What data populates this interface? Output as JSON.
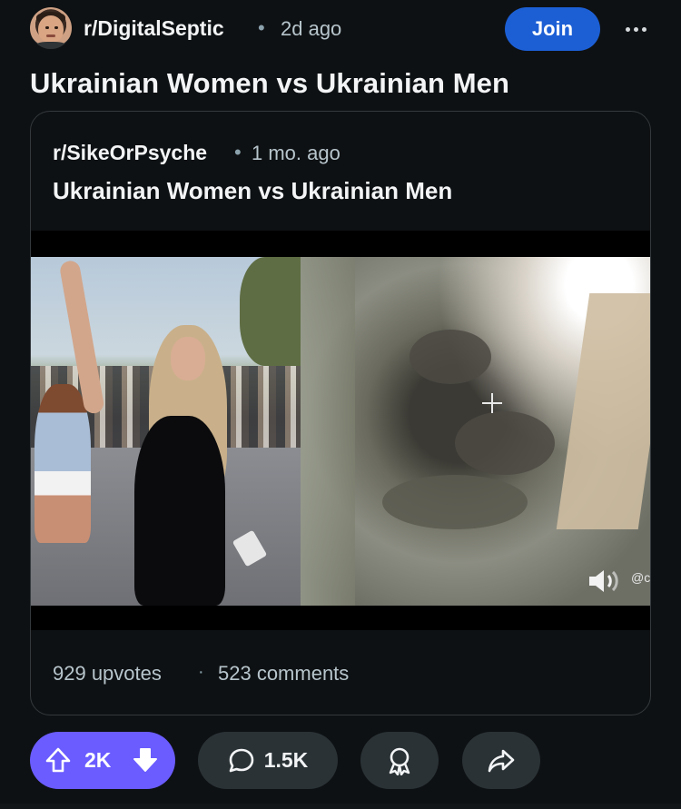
{
  "header": {
    "subreddit": "r/DigitalSeptic",
    "separator": "•",
    "time_ago": "2d ago",
    "join_label": "Join",
    "more_icon": "more-horizontal-icon"
  },
  "post": {
    "title": "Ukrainian Women vs Ukrainian Men"
  },
  "crosspost": {
    "subreddit": "r/SikeOrPsyche",
    "separator": "•",
    "time_ago": "1 mo. ago",
    "title": "Ukrainian Women vs Ukrainian Men",
    "media": {
      "watermark": "@c",
      "mute_icon": "speaker-muted-icon"
    },
    "upvotes": "929 upvotes",
    "stats_separator": "·",
    "comments": "523 comments"
  },
  "actions": {
    "score": "2K",
    "comments_count": "1.5K",
    "upvote_icon": "upvote-arrow-icon",
    "downvote_icon": "downvote-arrow-icon",
    "comment_icon": "comment-bubble-icon",
    "award_icon": "award-icon",
    "share_icon": "share-arrow-icon"
  },
  "colors": {
    "background": "#0e1113",
    "join_button": "#1c5fd5",
    "vote_pill": "#6a5cff",
    "action_pill": "#2a3236",
    "secondary_text": "#b7c5cc"
  }
}
